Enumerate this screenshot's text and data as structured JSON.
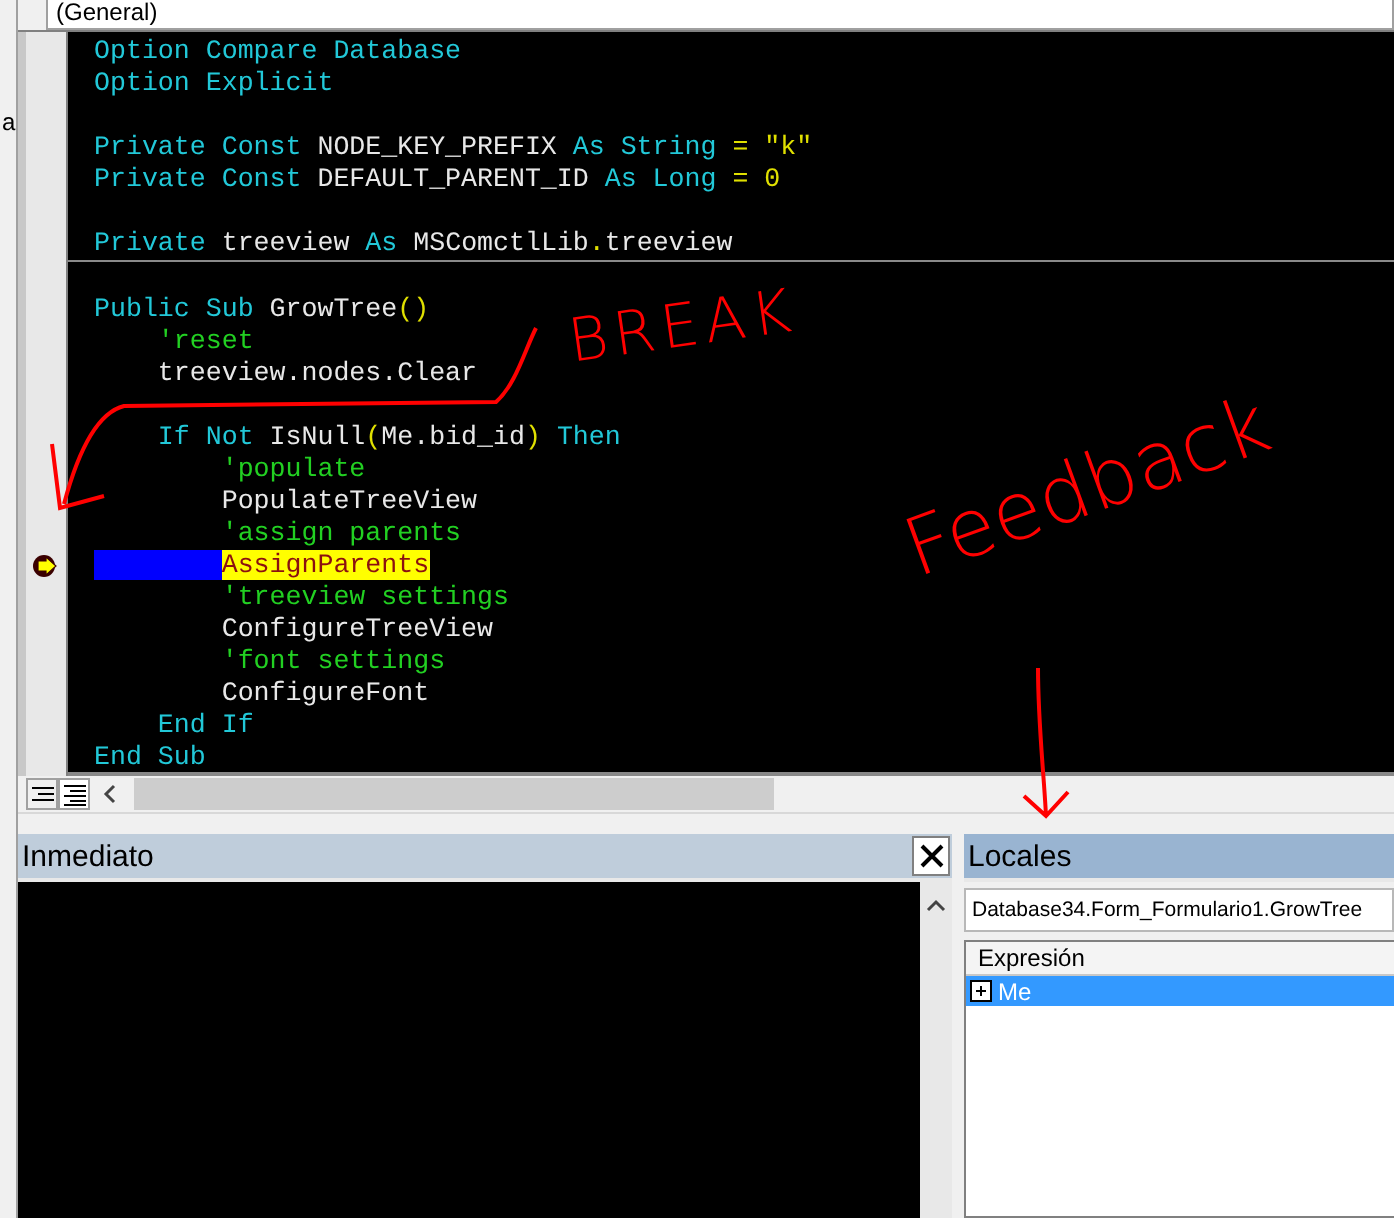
{
  "left_edge": {
    "text": "a"
  },
  "procedure_box": {
    "value": "(General)"
  },
  "code": {
    "lines": [
      {
        "kind": "code",
        "current": false,
        "tokens": [
          {
            "text": "Option Compare Database",
            "kind": "keyword"
          }
        ]
      },
      {
        "kind": "code",
        "current": false,
        "tokens": [
          {
            "text": "Option Explicit",
            "kind": "keyword"
          }
        ]
      },
      {
        "kind": "blank"
      },
      {
        "kind": "code",
        "current": false,
        "tokens": [
          {
            "text": "Private Const ",
            "kind": "keyword"
          },
          {
            "text": "NODE_KEY_PREFIX ",
            "kind": "ident"
          },
          {
            "text": "As String ",
            "kind": "keyword"
          },
          {
            "text": "= \"k\"",
            "kind": "punct"
          }
        ]
      },
      {
        "kind": "code",
        "current": false,
        "tokens": [
          {
            "text": "Private Const ",
            "kind": "keyword"
          },
          {
            "text": "DEFAULT_PARENT_ID ",
            "kind": "ident"
          },
          {
            "text": "As Long ",
            "kind": "keyword"
          },
          {
            "text": "= 0",
            "kind": "punct"
          }
        ]
      },
      {
        "kind": "blank"
      },
      {
        "kind": "code",
        "current": false,
        "tokens": [
          {
            "text": "Private ",
            "kind": "keyword"
          },
          {
            "text": "treeview ",
            "kind": "ident"
          },
          {
            "text": "As ",
            "kind": "keyword"
          },
          {
            "text": "MSComctlLib",
            "kind": "ident"
          },
          {
            "text": ".",
            "kind": "punct"
          },
          {
            "text": "treeview",
            "kind": "ident"
          }
        ]
      },
      {
        "kind": "separator"
      },
      {
        "kind": "blank"
      },
      {
        "kind": "code",
        "current": false,
        "tokens": [
          {
            "text": "Public Sub ",
            "kind": "keyword"
          },
          {
            "text": "GrowTree",
            "kind": "ident"
          },
          {
            "text": "()",
            "kind": "punct"
          }
        ]
      },
      {
        "kind": "code",
        "current": false,
        "tokens": [
          {
            "text": "    'reset",
            "kind": "comment"
          }
        ]
      },
      {
        "kind": "code",
        "current": false,
        "tokens": [
          {
            "text": "    treeview.nodes.Clear",
            "kind": "ident"
          }
        ]
      },
      {
        "kind": "blank"
      },
      {
        "kind": "code",
        "current": false,
        "tokens": [
          {
            "text": "    If Not ",
            "kind": "keyword"
          },
          {
            "text": "IsNull",
            "kind": "ident"
          },
          {
            "text": "(",
            "kind": "punct"
          },
          {
            "text": "Me.bid_id",
            "kind": "ident"
          },
          {
            "text": ") ",
            "kind": "punct"
          },
          {
            "text": "Then",
            "kind": "keyword"
          }
        ]
      },
      {
        "kind": "code",
        "current": false,
        "tokens": [
          {
            "text": "        'populate",
            "kind": "comment"
          }
        ]
      },
      {
        "kind": "code",
        "current": false,
        "tokens": [
          {
            "text": "        PopulateTreeView",
            "kind": "ident"
          }
        ]
      },
      {
        "kind": "code",
        "current": false,
        "tokens": [
          {
            "text": "        'assign parents",
            "kind": "comment"
          }
        ]
      },
      {
        "kind": "code",
        "current": true,
        "tokens": [
          {
            "text": "        AssignParents",
            "kind": "ident"
          }
        ]
      },
      {
        "kind": "code",
        "current": false,
        "tokens": [
          {
            "text": "        'treeview settings",
            "kind": "comment"
          }
        ]
      },
      {
        "kind": "code",
        "current": false,
        "tokens": [
          {
            "text": "        ConfigureTreeView",
            "kind": "ident"
          }
        ]
      },
      {
        "kind": "code",
        "current": false,
        "tokens": [
          {
            "text": "        'font settings",
            "kind": "comment"
          }
        ]
      },
      {
        "kind": "code",
        "current": false,
        "tokens": [
          {
            "text": "        ConfigureFont",
            "kind": "ident"
          }
        ]
      },
      {
        "kind": "code",
        "current": false,
        "tokens": [
          {
            "text": "    End If",
            "kind": "keyword"
          }
        ]
      },
      {
        "kind": "code",
        "current": false,
        "tokens": [
          {
            "text": "End Sub",
            "kind": "keyword"
          }
        ]
      }
    ]
  },
  "annotations": [
    {
      "text": "BREAK",
      "kind": "break"
    },
    {
      "text": "Feedback",
      "kind": "feedback"
    }
  ],
  "immediate": {
    "title": "Inmediato"
  },
  "locals": {
    "title": "Locales",
    "context": "Database34.Form_Formulario1.GrowTree",
    "column": "Expresión",
    "rows": [
      {
        "name": "Me",
        "selected": true
      }
    ]
  }
}
